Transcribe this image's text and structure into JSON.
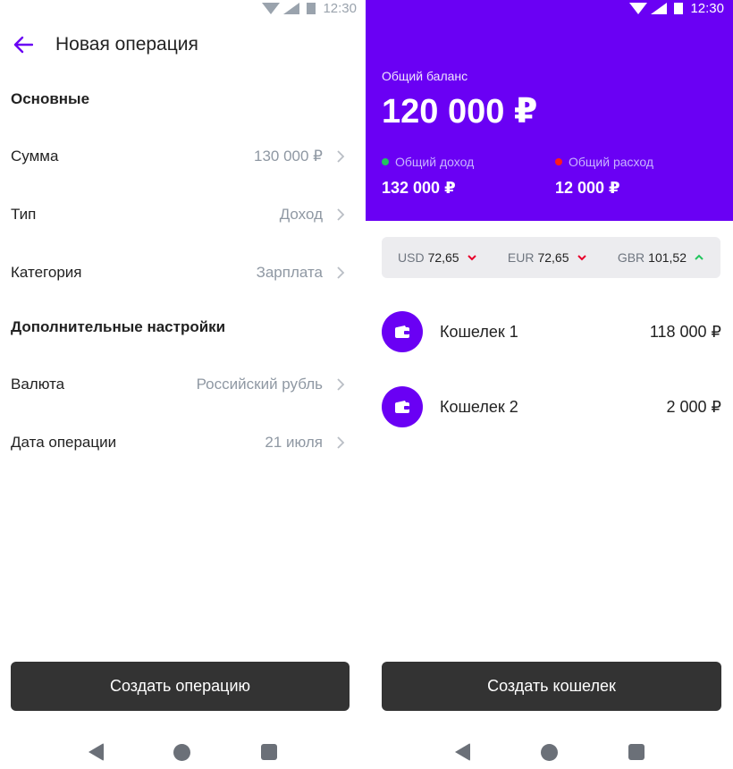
{
  "status": {
    "time": "12:30"
  },
  "operation_screen": {
    "title": "Новая операция",
    "sections": {
      "main": "Основные",
      "extra": "Дополнительные настройки"
    },
    "rows": {
      "amount": {
        "label": "Сумма",
        "value": "130 000 ₽"
      },
      "type": {
        "label": "Тип",
        "value": "Доход"
      },
      "category": {
        "label": "Категория",
        "value": "Зарплата"
      },
      "currency": {
        "label": "Валюта",
        "value": "Российский рубль"
      },
      "date": {
        "label": "Дата операции",
        "value": "21 июля"
      }
    },
    "cta": "Создать операцию"
  },
  "wallet_screen": {
    "balance_label": "Общий баланс",
    "balance_value": "120 000 ₽",
    "income": {
      "label": "Общий доход",
      "value": "132 000 ₽",
      "dot_color": "#22c55e"
    },
    "expense": {
      "label": "Общий расход",
      "value": "12 000 ₽",
      "dot_color": "#ff1a1a"
    },
    "rates": [
      {
        "code": "USD",
        "value": "72,65",
        "trend": "down"
      },
      {
        "code": "EUR",
        "value": "72,65",
        "trend": "down"
      },
      {
        "code": "GBR",
        "value": "101,52",
        "trend": "up"
      }
    ],
    "wallets": [
      {
        "name": "Кошелек 1",
        "amount": "118 000 ₽"
      },
      {
        "name": "Кошелек 2",
        "amount": "2 000 ₽"
      }
    ],
    "cta": "Создать кошелек"
  },
  "colors": {
    "accent": "#6a00f4",
    "button": "#333333",
    "down": "#e8002a",
    "up": "#22c55e"
  },
  "icons": [
    "back-arrow-icon",
    "chevron-right-icon",
    "wallet-icon",
    "chevron-down-icon",
    "chevron-up-icon",
    "nav-back-icon",
    "nav-home-icon",
    "nav-recent-icon",
    "wifi-icon",
    "signal-icon",
    "battery-icon"
  ]
}
